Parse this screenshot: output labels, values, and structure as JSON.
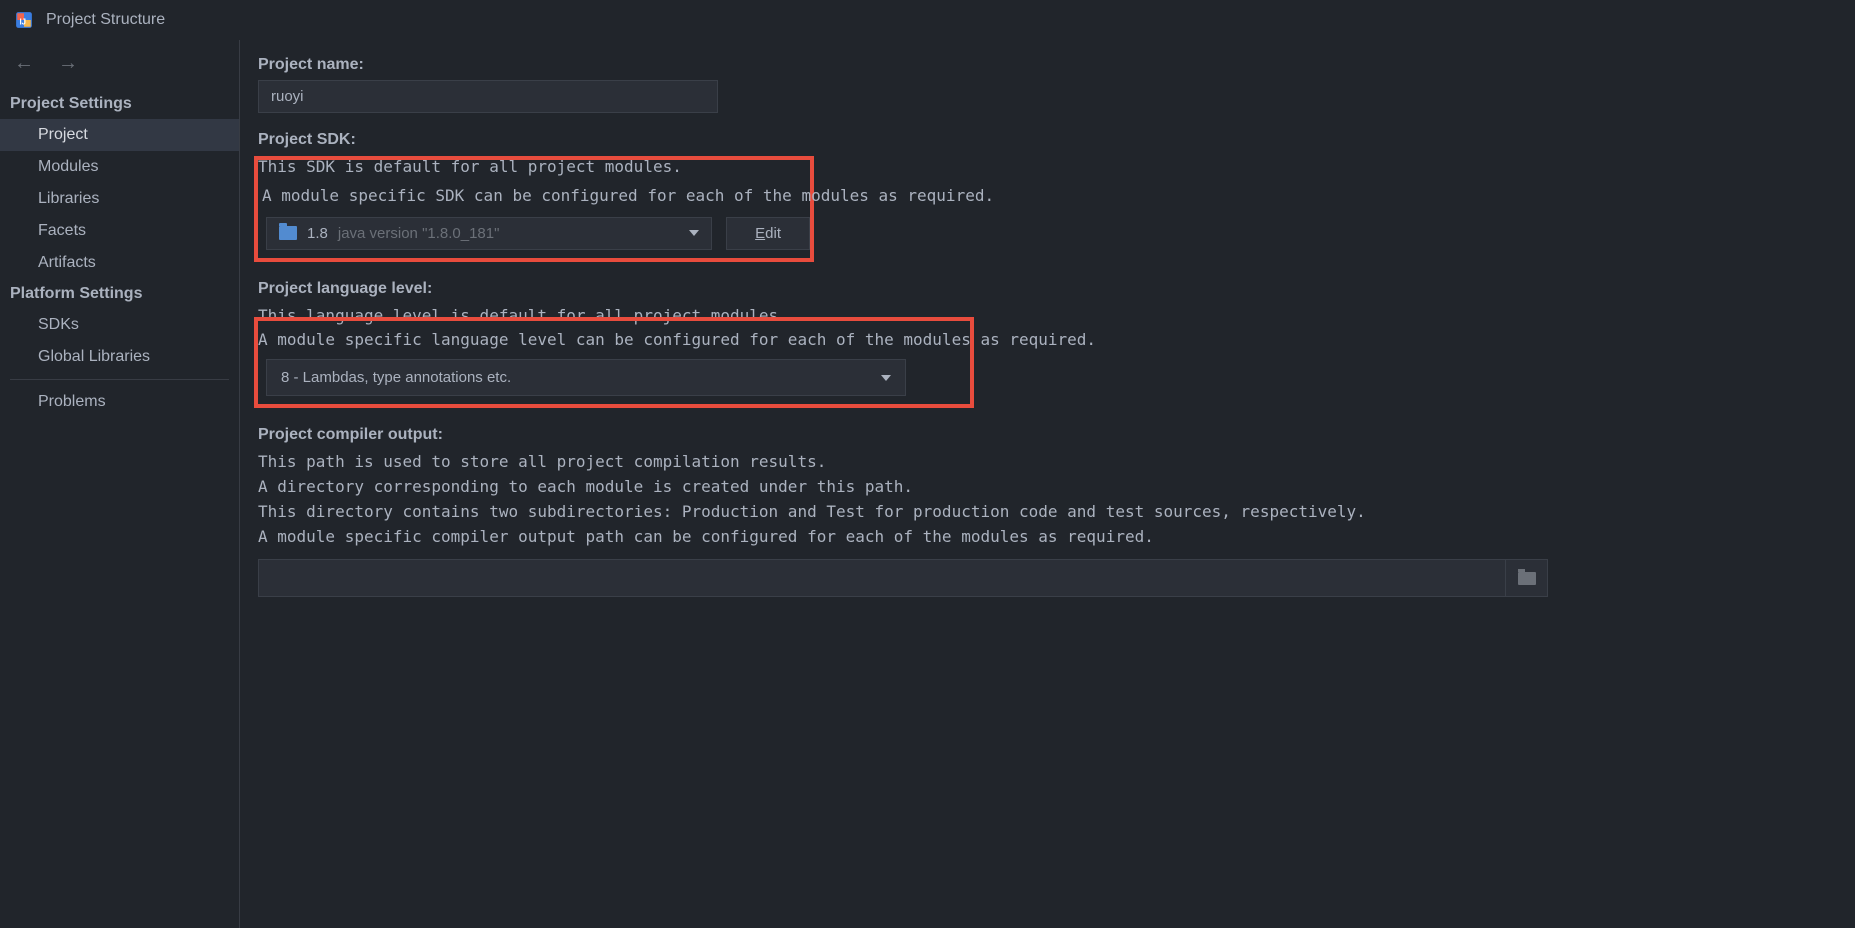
{
  "title": "Project Structure",
  "sidebar": {
    "section1_label": "Project Settings",
    "section2_label": "Platform Settings",
    "items1": [
      "Project",
      "Modules",
      "Libraries",
      "Facets",
      "Artifacts"
    ],
    "items2": [
      "SDKs",
      "Global Libraries"
    ],
    "problems": "Problems",
    "selected": "Project"
  },
  "project_name": {
    "label": "Project name:",
    "value": "ruoyi"
  },
  "project_sdk": {
    "label": "Project SDK:",
    "desc1": "This SDK is default for all project modules.",
    "desc2": "A module specific SDK can be configured for each of the modules as required.",
    "version": "1.8",
    "detail": "java version \"1.8.0_181\"",
    "edit_prefix": "E",
    "edit_suffix": "dit"
  },
  "lang_level": {
    "label": "Project language level:",
    "desc1": "This language level is default for all project modules.",
    "desc2": "A module specific language level can be configured for each of the modules as required.",
    "value": "8 - Lambdas, type annotations etc."
  },
  "compiler_output": {
    "label": "Project compiler output:",
    "desc1": "This path is used to store all project compilation results.",
    "desc2": "A directory corresponding to each module is created under this path.",
    "desc3": "This directory contains two subdirectories: Production and Test for production code and test sources, respectively.",
    "desc4": "A module specific compiler output path can be configured for each of the modules as required.",
    "value": ""
  }
}
